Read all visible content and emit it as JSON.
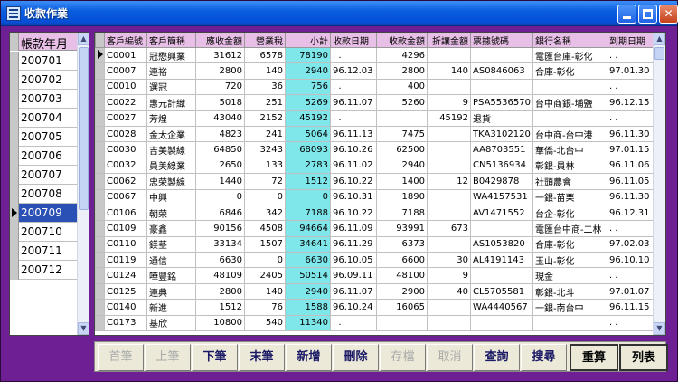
{
  "window": {
    "title": "收款作業"
  },
  "left_list": {
    "header": "帳款年月",
    "items": [
      "200701",
      "200702",
      "200703",
      "200704",
      "200705",
      "200706",
      "200707",
      "200708",
      "200709",
      "200710",
      "200711",
      "200712"
    ],
    "selected_index": 8
  },
  "grid": {
    "columns": [
      "客戶編號",
      "客戶簡稱",
      "應收金額",
      "營業稅",
      "小計",
      "收款日期",
      "收款金額",
      "折讓金額",
      "票據號碼",
      "銀行名稱",
      "到期日期"
    ],
    "current_row": 0,
    "rows": [
      [
        "C0001",
        "冠懋興業",
        "31612",
        "6578",
        "78190",
        ". .",
        "4296",
        "",
        "",
        "電匯台庫-彰化",
        ". ."
      ],
      [
        "C0007",
        "連裕",
        "2800",
        "140",
        "2940",
        "96.12.03",
        "2800",
        "140",
        "AS0846063",
        "合庫-彰化",
        "97.01.30"
      ],
      [
        "C0010",
        "選冠",
        "720",
        "36",
        "756",
        ". .",
        "400",
        "",
        "",
        "",
        ". ."
      ],
      [
        "C0022",
        "惠元計織",
        "5018",
        "251",
        "5269",
        "96.11.07",
        "5260",
        "9",
        "PSA5536570",
        "台中商銀-埔鹽",
        "96.12.15"
      ],
      [
        "C0027",
        "芳煌",
        "43040",
        "2152",
        "45192",
        ". .",
        "",
        "45192",
        "退貨",
        "",
        ". ."
      ],
      [
        "C0028",
        "金太企業",
        "4823",
        "241",
        "5064",
        "96.11.13",
        "7475",
        "",
        "TKA3102120",
        "台中商-台中港",
        "96.11.30"
      ],
      [
        "C0030",
        "吉美製線",
        "64850",
        "3243",
        "68093",
        "96.10.26",
        "62500",
        "",
        "AA8703551",
        "華僑-北台中",
        "97.01.15"
      ],
      [
        "C0032",
        "員美線業",
        "2650",
        "133",
        "2783",
        "96.11.02",
        "2940",
        "",
        "CN5136934",
        "彰銀-員林",
        "96.11.06"
      ],
      [
        "C0062",
        "忠荣製線",
        "1440",
        "72",
        "1512",
        "96.10.22",
        "1400",
        "12",
        "B0429878",
        "社頭農會",
        "96.11.05"
      ],
      [
        "C0067",
        "中興",
        "0",
        "0",
        "0",
        "96.10.31",
        "1890",
        "",
        "WA4157531",
        "一銀-苗栗",
        "96.11.30"
      ],
      [
        "C0106",
        "朝荣",
        "6846",
        "342",
        "7188",
        "96.10.22",
        "7188",
        "",
        "AV1471552",
        "台企-彰化",
        "96.12.31"
      ],
      [
        "C0109",
        "豪鑫",
        "90156",
        "4508",
        "94664",
        "96.11.09",
        "93991",
        "673",
        "",
        "電匯台中商-二林",
        ". ."
      ],
      [
        "C0110",
        "鎂茎",
        "33134",
        "1507",
        "34641",
        "96.11.29",
        "6373",
        "",
        "AS1053820",
        "合庫-彰化",
        "97.02.03"
      ],
      [
        "C0119",
        "通信",
        "6630",
        "0",
        "6630",
        "96.10.05",
        "6600",
        "30",
        "AL4191143",
        "玉山-彰化",
        "96.10.10"
      ],
      [
        "C0124",
        "嘩豐銘",
        "48109",
        "2405",
        "50514",
        "96.09.11",
        "48100",
        "9",
        "",
        "現金",
        ". ."
      ],
      [
        "C0125",
        "連典",
        "2800",
        "140",
        "2940",
        "96.11.07",
        "2900",
        "40",
        "CL5705581",
        "彰銀-北斗",
        "97.01.07"
      ],
      [
        "C0140",
        "新進",
        "1512",
        "76",
        "1588",
        "96.10.24",
        "16065",
        "",
        "WA4440567",
        "一銀-南台中",
        "96.11.15"
      ],
      [
        "C0173",
        "基欣",
        "10800",
        "540",
        "11340",
        ". .",
        "",
        "",
        "",
        "",
        ". ."
      ]
    ]
  },
  "buttons": [
    {
      "label": "首筆",
      "enabled": false
    },
    {
      "label": "上筆",
      "enabled": false
    },
    {
      "label": "下筆",
      "enabled": true
    },
    {
      "label": "末筆",
      "enabled": true
    },
    {
      "label": "新增",
      "enabled": true
    },
    {
      "label": "刪除",
      "enabled": true
    },
    {
      "label": "存檔",
      "enabled": false
    },
    {
      "label": "取消",
      "enabled": false
    },
    {
      "label": "查詢",
      "enabled": true
    },
    {
      "label": "搜尋",
      "enabled": true
    },
    {
      "label": "重算",
      "enabled": true
    },
    {
      "label": "列表",
      "enabled": true
    }
  ],
  "colors": {
    "titlebar": "#0a5ee0",
    "window_bg": "#6e1f93",
    "header_bg": "#e8bfe6",
    "subtotal_bg": "#7fe6ea",
    "selected_bg": "#2a4fb5"
  }
}
